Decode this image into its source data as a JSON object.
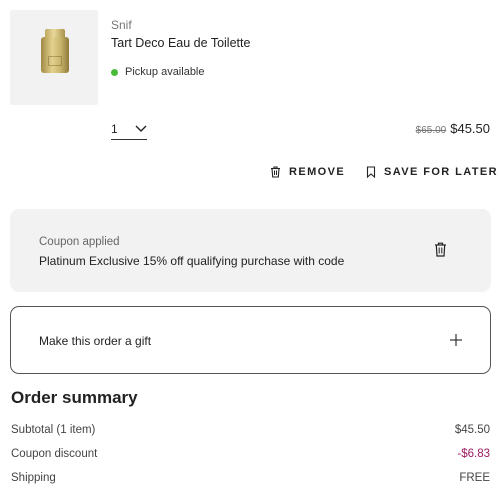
{
  "product": {
    "brand": "Snif",
    "name": "Tart Deco Eau de Toilette",
    "availability": "Pickup available",
    "availability_color": "#4cbb3c",
    "quantity": "1",
    "original_price": "$65.00",
    "price": "$45.50"
  },
  "actions": {
    "remove_label": "REMOVE",
    "save_label": "SAVE FOR LATER"
  },
  "coupon": {
    "heading": "Coupon applied",
    "description": "Platinum Exclusive 15% off qualifying purchase with code"
  },
  "gift": {
    "label": "Make this order a gift"
  },
  "summary": {
    "title": "Order summary",
    "rows": [
      {
        "label": "Subtotal (1 item)",
        "value": "$45.50"
      },
      {
        "label": "Coupon discount",
        "value": "-$6.83",
        "color": "#9c1a5e"
      },
      {
        "label": "Shipping",
        "value": "FREE"
      }
    ]
  }
}
